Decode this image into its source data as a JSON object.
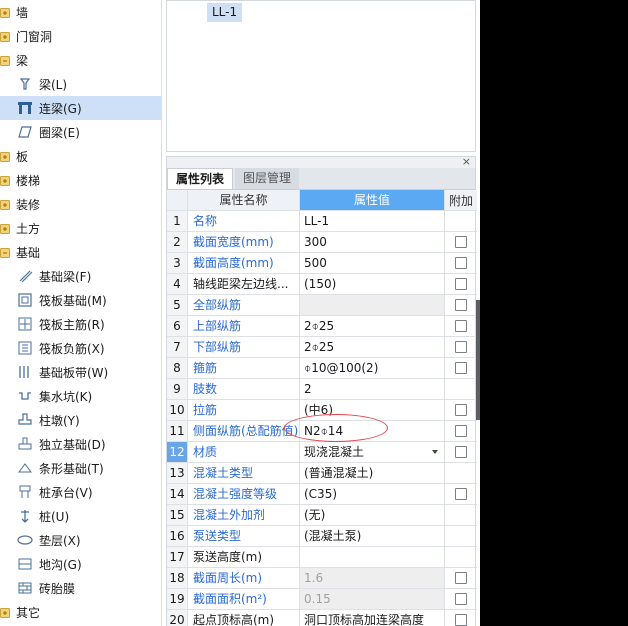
{
  "tree": {
    "items": [
      {
        "label": "墙",
        "type": "folder",
        "icon": "plus-folder-icon"
      },
      {
        "label": "门窗洞",
        "type": "folder",
        "icon": "plus-folder-icon"
      },
      {
        "label": "梁",
        "type": "folder-open",
        "icon": "minus-folder-icon"
      },
      {
        "label": "梁(L)",
        "type": "child",
        "icon": "beam-icon"
      },
      {
        "label": "连梁(G)",
        "type": "child",
        "icon": "coupling-beam-icon",
        "selected": true
      },
      {
        "label": "圈梁(E)",
        "type": "child",
        "icon": "ring-beam-icon"
      },
      {
        "label": "板",
        "type": "folder",
        "icon": "plus-folder-icon"
      },
      {
        "label": "楼梯",
        "type": "folder",
        "icon": "plus-folder-icon"
      },
      {
        "label": "装修",
        "type": "folder",
        "icon": "plus-folder-icon"
      },
      {
        "label": "土方",
        "type": "folder",
        "icon": "plus-folder-icon"
      },
      {
        "label": "基础",
        "type": "folder-open",
        "icon": "minus-folder-icon"
      },
      {
        "label": "基础梁(F)",
        "type": "child",
        "icon": "foundation-beam-icon"
      },
      {
        "label": "筏板基础(M)",
        "type": "child",
        "icon": "raft-foundation-icon"
      },
      {
        "label": "筏板主筋(R)",
        "type": "child",
        "icon": "raft-main-rebar-icon"
      },
      {
        "label": "筏板负筋(X)",
        "type": "child",
        "icon": "raft-negative-rebar-icon"
      },
      {
        "label": "基础板带(W)",
        "type": "child",
        "icon": "foundation-strip-icon"
      },
      {
        "label": "集水坑(K)",
        "type": "child",
        "icon": "sump-pit-icon"
      },
      {
        "label": "柱墩(Y)",
        "type": "child",
        "icon": "column-pier-icon"
      },
      {
        "label": "独立基础(D)",
        "type": "child",
        "icon": "isolated-foundation-icon"
      },
      {
        "label": "条形基础(T)",
        "type": "child",
        "icon": "strip-foundation-icon"
      },
      {
        "label": "桩承台(V)",
        "type": "child",
        "icon": "pile-cap-icon"
      },
      {
        "label": "桩(U)",
        "type": "child",
        "icon": "pile-icon"
      },
      {
        "label": "垫层(X)",
        "type": "child",
        "icon": "cushion-icon"
      },
      {
        "label": "地沟(G)",
        "type": "child",
        "icon": "trench-icon"
      },
      {
        "label": "砖胎膜",
        "type": "child",
        "icon": "brick-mold-icon"
      },
      {
        "label": "其它",
        "type": "folder",
        "icon": "plus-folder-icon"
      }
    ]
  },
  "preview": {
    "tag": "LL-1"
  },
  "panel": {
    "close": "×",
    "tabs": [
      {
        "label": "属性列表",
        "active": true
      },
      {
        "label": "图层管理",
        "active": false
      }
    ],
    "headers": {
      "name": "属性名称",
      "value": "属性值",
      "extra": "附加"
    },
    "rows": [
      {
        "num": "1",
        "name": "名称",
        "value": "LL-1",
        "blue": true,
        "check": false
      },
      {
        "num": "2",
        "name": "截面宽度(mm)",
        "value": "300",
        "blue": true,
        "check": true
      },
      {
        "num": "3",
        "name": "截面高度(mm)",
        "value": "500",
        "blue": true,
        "check": true
      },
      {
        "num": "4",
        "name": "轴线距梁左边线...",
        "value": "(150)",
        "blue": false,
        "check": true
      },
      {
        "num": "5",
        "name": "全部纵筋",
        "value": "",
        "blue": true,
        "check": true,
        "greyCell": true
      },
      {
        "num": "6",
        "name": "上部纵筋",
        "value": "2⌽25",
        "blue": true,
        "check": true
      },
      {
        "num": "7",
        "name": "下部纵筋",
        "value": "2⌽25",
        "blue": true,
        "check": true
      },
      {
        "num": "8",
        "name": "箍筋",
        "value": "⌽10@100(2)",
        "blue": true,
        "check": true
      },
      {
        "num": "9",
        "name": "肢数",
        "value": "2",
        "blue": true,
        "check": false
      },
      {
        "num": "10",
        "name": "拉筋",
        "value": "(中6)",
        "blue": true,
        "check": true
      },
      {
        "num": "11",
        "name": "侧面纵筋(总配筋值)",
        "value": "N2⌽14",
        "blue": true,
        "check": true
      },
      {
        "num": "12",
        "name": "材质",
        "value": "现浇混凝土",
        "blue": true,
        "check": true,
        "selected": true,
        "dropdown": true
      },
      {
        "num": "13",
        "name": "混凝土类型",
        "value": "(普通混凝土)",
        "blue": true,
        "check": false
      },
      {
        "num": "14",
        "name": "混凝土强度等级",
        "value": "(C35)",
        "blue": true,
        "check": true
      },
      {
        "num": "15",
        "name": "混凝土外加剂",
        "value": "(无)",
        "blue": true,
        "check": false
      },
      {
        "num": "16",
        "name": "泵送类型",
        "value": "(混凝土泵)",
        "blue": true,
        "check": false
      },
      {
        "num": "17",
        "name": "泵送高度(m)",
        "value": "",
        "blue": false,
        "check": false
      },
      {
        "num": "18",
        "name": "截面周长(m)",
        "value": "1.6",
        "blue": true,
        "check": true,
        "greyCell": true,
        "greyText": true
      },
      {
        "num": "19",
        "name": "截面面积(m²)",
        "value": "0.15",
        "blue": true,
        "check": true,
        "greyCell": true,
        "greyText": true
      },
      {
        "num": "20",
        "name": "起点顶标高(m)",
        "value": "洞口顶标高加连梁高度",
        "blue": false,
        "check": true
      }
    ]
  },
  "colors": {
    "selection": "#cde0f7",
    "header_value_bg": "#5aa9f2",
    "label_blue": "#2a6bd0",
    "annotation_red": "#e0474c"
  }
}
